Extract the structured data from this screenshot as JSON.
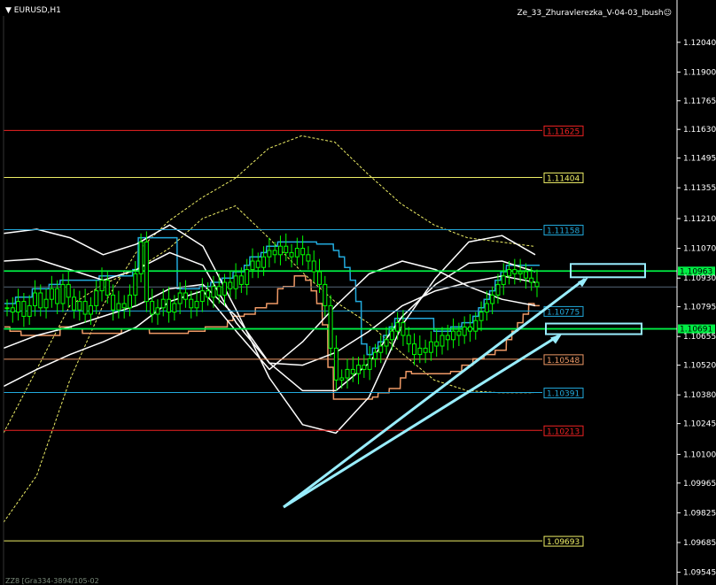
{
  "window": {
    "symbol_label": "EURUSD,H1",
    "indicator_label": "Ze_33_Zhuravlerezka_V-04-03_Ibush☺",
    "bottom_label": "ZZ8 [Gra334-3894/105-02"
  },
  "colors": {
    "background": "#000000",
    "candle": "#00ff00",
    "axis": "#ffffff",
    "channel_white": "#ffffff",
    "cyan_step": "#22aadd",
    "orange_step": "#ee9966",
    "yellow_dashed": "#eeee66",
    "annotation": "#99eeff",
    "green_level": "#00ee44"
  },
  "chart_data": {
    "type": "line",
    "title": "EURUSD,H1",
    "y_axis_ticks": [
      "1.12040",
      "1.11900",
      "1.11765",
      "1.11630",
      "1.11495",
      "1.11355",
      "1.11210",
      "1.11070",
      "1.10930",
      "1.10795",
      "1.10655",
      "1.10520",
      "1.10380",
      "1.10245",
      "1.10100",
      "1.09965",
      "1.09825",
      "1.09685",
      "1.09545"
    ],
    "ylim": [
      1.0951,
      1.1216
    ],
    "grid": false,
    "current_price": "1.10888",
    "current_price_color": "#ffffff",
    "levels": [
      {
        "value": 1.11625,
        "label": "1.11625",
        "color": "#ee2222"
      },
      {
        "value": 1.11404,
        "label": "1.11404",
        "color": "#eeee66"
      },
      {
        "value": 1.11158,
        "label": "1.11158",
        "color": "#22aadd"
      },
      {
        "value": 1.10963,
        "label": "1.10963",
        "color": "#00ee44"
      },
      {
        "value": 1.10775,
        "label": "1.10775",
        "color": "#22aadd"
      },
      {
        "value": 1.10691,
        "label": "1.10691",
        "color": "#00ee44"
      },
      {
        "value": 1.10548,
        "label": "1.10548",
        "color": "#ee9966"
      },
      {
        "value": 1.10391,
        "label": "1.10391",
        "color": "#22aadd"
      },
      {
        "value": 1.10213,
        "label": "1.10213",
        "color": "#ee2222"
      },
      {
        "value": 1.09693,
        "label": "1.09693",
        "color": "#eeee66"
      }
    ],
    "price_series": [
      1.1079,
      1.1077,
      1.1082,
      1.1075,
      1.108,
      1.1086,
      1.1079,
      1.1083,
      1.1088,
      1.1081,
      1.109,
      1.1084,
      1.1078,
      1.1082,
      1.1076,
      1.108,
      1.1087,
      1.1092,
      1.1085,
      1.1078,
      1.1081,
      1.1079,
      1.1085,
      1.1095,
      1.111,
      1.1082,
      1.1076,
      1.1079,
      1.1083,
      1.1077,
      1.1081,
      1.1086,
      1.1083,
      1.1079,
      1.1082,
      1.1087,
      1.1084,
      1.1089,
      1.1085,
      1.1091,
      1.1088,
      1.1094,
      1.109,
      1.1097,
      1.1101,
      1.1098,
      1.1103,
      1.1106,
      1.1104,
      1.1108,
      1.1105,
      1.1103,
      1.1107,
      1.1104,
      1.1101,
      1.1096,
      1.109,
      1.108,
      1.106,
      1.1045,
      1.1046,
      1.105,
      1.1048,
      1.1052,
      1.105,
      1.1055,
      1.1058,
      1.1061,
      1.1064,
      1.1068,
      1.1072,
      1.1066,
      1.1062,
      1.1057,
      1.106,
      1.1058,
      1.1063,
      1.1061,
      1.1066,
      1.1064,
      1.1068,
      1.1066,
      1.107,
      1.1068,
      1.1073,
      1.1077,
      1.1081,
      1.1085,
      1.109,
      1.1094,
      1.1097,
      1.1095,
      1.1096,
      1.1093,
      1.1091,
      1.1089
    ],
    "channel_series": [
      {
        "name": "",
        "values": [
          1.1114,
          1.1116,
          1.1112,
          1.1104,
          1.1109,
          1.1118,
          1.1108,
          1.1078,
          1.1046,
          1.1024,
          1.102,
          1.1037,
          1.1071,
          1.1093,
          1.111,
          1.1113,
          1.1104
        ]
      },
      {
        "name": "",
        "values": [
          1.1101,
          1.1102,
          1.1097,
          1.1092,
          1.1097,
          1.1105,
          1.1099,
          1.1072,
          1.1053,
          1.104,
          1.104,
          1.1053,
          1.1075,
          1.109,
          1.11,
          1.1101,
          1.1096
        ]
      },
      {
        "name": "",
        "values": [
          1.106,
          1.1066,
          1.107,
          1.1075,
          1.108,
          1.1088,
          1.109,
          1.1075,
          1.1053,
          1.1052,
          1.1058,
          1.1068,
          1.108,
          1.1087,
          1.1091,
          1.1094,
          1.1091
        ]
      },
      {
        "name": "",
        "values": [
          1.1042,
          1.105,
          1.1057,
          1.1063,
          1.107,
          1.1082,
          1.1087,
          1.1068,
          1.105,
          1.1063,
          1.108,
          1.1095,
          1.1101,
          1.1097,
          1.1089,
          1.1083,
          1.108
        ]
      }
    ],
    "dashed_series": [
      {
        "name": "",
        "values": [
          1.0978,
          1.1,
          1.1045,
          1.108,
          1.1105,
          1.112,
          1.1131,
          1.114,
          1.1154,
          1.116,
          1.1157,
          1.1142,
          1.1128,
          1.1118,
          1.1112,
          1.111,
          1.1108
        ]
      },
      {
        "name": "",
        "values": [
          1.102,
          1.105,
          1.108,
          1.109,
          1.1097,
          1.1107,
          1.1121,
          1.1127,
          1.1112,
          1.1096,
          1.1082,
          1.1072,
          1.1058,
          1.1045,
          1.104,
          1.1039,
          1.1039
        ]
      }
    ]
  }
}
